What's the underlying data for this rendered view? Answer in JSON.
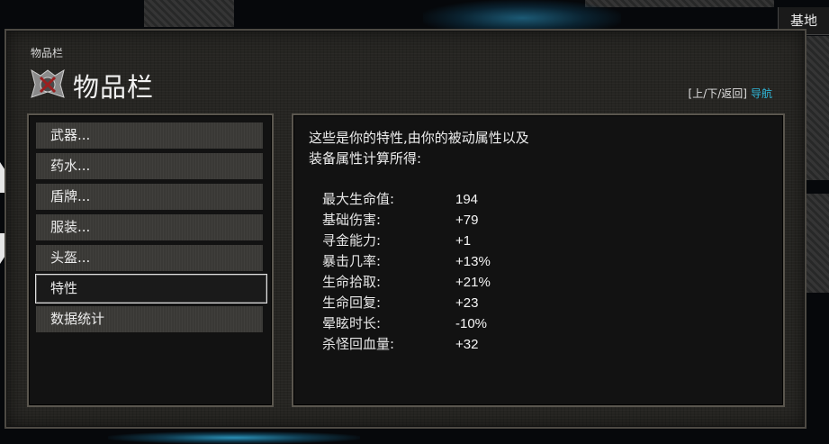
{
  "location": "基地",
  "breadcrumb": "物品栏",
  "title": "物品栏",
  "icon_name": "crest-icon",
  "nav_hint": {
    "keys": "[上/下/返回]",
    "action": "导航"
  },
  "menu": {
    "items": [
      {
        "label": "武器..."
      },
      {
        "label": "药水..."
      },
      {
        "label": "盾牌..."
      },
      {
        "label": "服装..."
      },
      {
        "label": "头盔..."
      },
      {
        "label": "特性"
      },
      {
        "label": "数据统计"
      }
    ],
    "selected": "特性"
  },
  "detail": {
    "intro_line1": "这些是你的特性,由你的被动属性以及",
    "intro_line2": "装备属性计算所得:",
    "stats": [
      {
        "label": "最大生命值:",
        "value": "194"
      },
      {
        "label": "基础伤害:",
        "value": "+79"
      },
      {
        "label": "寻金能力:",
        "value": "+1"
      },
      {
        "label": "暴击几率:",
        "value": "+13%"
      },
      {
        "label": "生命拾取:",
        "value": "+21%"
      },
      {
        "label": "生命回复:",
        "value": "+23"
      },
      {
        "label": "晕眩时长:",
        "value": "-10%"
      },
      {
        "label": "杀怪回血量:",
        "value": "+32"
      }
    ]
  },
  "colors": {
    "accent": "#2fb6d8",
    "panel": "#262522",
    "button": "#3a3936"
  }
}
